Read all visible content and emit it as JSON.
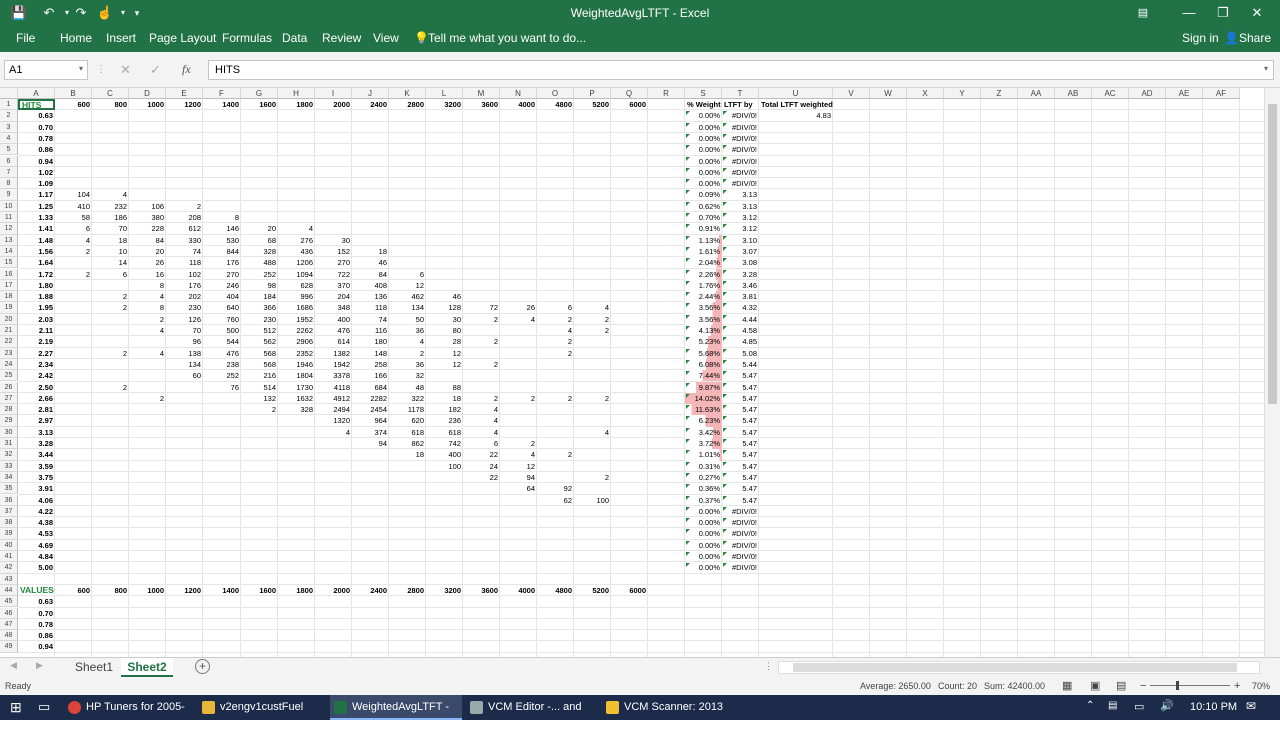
{
  "window": {
    "title": "WeightedAvgLTFT - Excel"
  },
  "ribbon": {
    "tabs": [
      "File",
      "Home",
      "Insert",
      "Page Layout",
      "Formulas",
      "Data",
      "Review",
      "View"
    ],
    "tell_me": "Tell me what you want to do...",
    "sign_in": "Sign in",
    "share": "Share"
  },
  "formula_bar": {
    "name_box": "A1",
    "value": "HITS"
  },
  "columns": [
    "A",
    "B",
    "C",
    "D",
    "E",
    "F",
    "G",
    "H",
    "I",
    "J",
    "K",
    "L",
    "M",
    "N",
    "O",
    "P",
    "Q",
    "R",
    "S",
    "T",
    "U",
    "V",
    "W",
    "X",
    "Y",
    "Z",
    "AA",
    "AB",
    "AC",
    "AD",
    "AE",
    "AF"
  ],
  "grid": {
    "header_row": {
      "label": "HITS",
      "rpm": [
        "600",
        "800",
        "1000",
        "1200",
        "1400",
        "1600",
        "1800",
        "2000",
        "2400",
        "2800",
        "3200",
        "3600",
        "4000",
        "4800",
        "5200",
        "6000"
      ],
      "s": "% Weight",
      "t": "LTFT by",
      "u": "Total LTFT weighted"
    },
    "u2": "4.83",
    "rows": [
      {
        "a": "0.63",
        "s": "0.00%",
        "t": "#DIV/0!",
        "v": {}
      },
      {
        "a": "0.70",
        "s": "0.00%",
        "t": "#DIV/0!",
        "v": {}
      },
      {
        "a": "0.78",
        "s": "0.00%",
        "t": "#DIV/0!",
        "v": {}
      },
      {
        "a": "0.86",
        "s": "0.00%",
        "t": "#DIV/0!",
        "v": {}
      },
      {
        "a": "0.94",
        "s": "0.00%",
        "t": "#DIV/0!",
        "v": {}
      },
      {
        "a": "1.02",
        "s": "0.00%",
        "t": "#DIV/0!",
        "v": {}
      },
      {
        "a": "1.09",
        "s": "0.00%",
        "t": "#DIV/0!",
        "v": {}
      },
      {
        "a": "1.17",
        "s": "0.09%",
        "t": "3.13",
        "v": {
          "B": "104",
          "C": "4"
        }
      },
      {
        "a": "1.25",
        "s": "0.62%",
        "t": "3.13",
        "v": {
          "B": "410",
          "C": "232",
          "D": "106",
          "E": "2"
        }
      },
      {
        "a": "1.33",
        "s": "0.70%",
        "t": "3.12",
        "v": {
          "B": "58",
          "C": "186",
          "D": "380",
          "E": "208",
          "F": "8"
        }
      },
      {
        "a": "1.41",
        "s": "0.91%",
        "t": "3.12",
        "v": {
          "B": "6",
          "C": "70",
          "D": "228",
          "E": "612",
          "F": "146",
          "G": "20",
          "H": "4"
        }
      },
      {
        "a": "1.48",
        "s": "1.13%",
        "t": "3.10",
        "v": {
          "B": "4",
          "C": "18",
          "D": "84",
          "E": "330",
          "F": "530",
          "G": "68",
          "H": "276",
          "I": "30"
        }
      },
      {
        "a": "1.56",
        "s": "1.61%",
        "t": "3.07",
        "v": {
          "B": "2",
          "C": "10",
          "D": "20",
          "E": "74",
          "F": "844",
          "G": "328",
          "H": "436",
          "I": "152",
          "J": "18"
        }
      },
      {
        "a": "1.64",
        "s": "2.04%",
        "t": "3.08",
        "v": {
          "C": "14",
          "D": "26",
          "E": "118",
          "F": "176",
          "G": "488",
          "H": "1206",
          "I": "270",
          "J": "46"
        }
      },
      {
        "a": "1.72",
        "s": "2.26%",
        "t": "3.28",
        "v": {
          "B": "2",
          "C": "6",
          "D": "16",
          "E": "102",
          "F": "270",
          "G": "252",
          "H": "1094",
          "I": "722",
          "J": "84",
          "K": "6"
        }
      },
      {
        "a": "1.80",
        "s": "1.76%",
        "t": "3.46",
        "v": {
          "D": "8",
          "E": "176",
          "F": "246",
          "G": "98",
          "H": "628",
          "I": "370",
          "J": "408",
          "K": "12"
        }
      },
      {
        "a": "1.88",
        "s": "2.44%",
        "t": "3.81",
        "v": {
          "C": "2",
          "D": "4",
          "E": "202",
          "F": "404",
          "G": "184",
          "H": "996",
          "I": "204",
          "J": "136",
          "K": "462",
          "L": "46"
        }
      },
      {
        "a": "1.95",
        "s": "3.56%",
        "t": "4.32",
        "v": {
          "C": "2",
          "D": "8",
          "E": "230",
          "F": "640",
          "G": "366",
          "H": "1686",
          "I": "348",
          "J": "118",
          "K": "134",
          "L": "128",
          "M": "72",
          "N": "26",
          "O": "6",
          "P": "4"
        }
      },
      {
        "a": "2.03",
        "s": "3.56%",
        "t": "4.44",
        "v": {
          "D": "2",
          "E": "126",
          "F": "760",
          "G": "230",
          "H": "1952",
          "I": "400",
          "J": "74",
          "K": "50",
          "L": "30",
          "M": "2",
          "N": "4",
          "O": "2",
          "P": "2"
        }
      },
      {
        "a": "2.11",
        "s": "4.13%",
        "t": "4.58",
        "v": {
          "D": "4",
          "E": "70",
          "F": "500",
          "G": "512",
          "H": "2262",
          "I": "476",
          "J": "116",
          "K": "36",
          "L": "80",
          "O": "4",
          "P": "2"
        }
      },
      {
        "a": "2.19",
        "s": "5.23%",
        "t": "4.85",
        "v": {
          "E": "96",
          "F": "544",
          "G": "562",
          "H": "2906",
          "I": "614",
          "J": "180",
          "K": "4",
          "L": "28",
          "M": "2",
          "O": "2"
        }
      },
      {
        "a": "2.27",
        "s": "5.68%",
        "t": "5.08",
        "v": {
          "C": "2",
          "D": "4",
          "E": "138",
          "F": "476",
          "G": "568",
          "H": "2352",
          "I": "1382",
          "J": "148",
          "K": "2",
          "L": "12",
          "O": "2"
        }
      },
      {
        "a": "2.34",
        "s": "6.08%",
        "t": "5.44",
        "v": {
          "E": "134",
          "F": "238",
          "G": "568",
          "H": "1946",
          "I": "1942",
          "J": "258",
          "K": "36",
          "L": "12",
          "M": "2"
        }
      },
      {
        "a": "2.42",
        "s": "7.44%",
        "t": "5.47",
        "v": {
          "E": "60",
          "F": "252",
          "G": "216",
          "H": "1804",
          "I": "3378",
          "J": "166",
          "K": "32"
        }
      },
      {
        "a": "2.50",
        "s": "9.87%",
        "t": "5.47",
        "v": {
          "C": "2",
          "F": "76",
          "G": "514",
          "H": "1730",
          "I": "4118",
          "J": "684",
          "K": "48",
          "L": "88"
        }
      },
      {
        "a": "2.66",
        "s": "14.02%",
        "t": "5.47",
        "v": {
          "D": "2",
          "G": "132",
          "H": "1632",
          "I": "4912",
          "J": "2282",
          "K": "322",
          "L": "18",
          "M": "2",
          "N": "2",
          "O": "2",
          "P": "2"
        }
      },
      {
        "a": "2.81",
        "s": "11.63%",
        "t": "5.47",
        "v": {
          "G": "2",
          "H": "328",
          "I": "2494",
          "J": "2454",
          "K": "1178",
          "L": "182",
          "M": "4"
        }
      },
      {
        "a": "2.97",
        "s": "6.23%",
        "t": "5.47",
        "v": {
          "I": "1320",
          "J": "964",
          "K": "620",
          "L": "236",
          "M": "4"
        }
      },
      {
        "a": "3.13",
        "s": "3.42%",
        "t": "5.47",
        "v": {
          "I": "4",
          "J": "374",
          "K": "618",
          "L": "618",
          "M": "4",
          "P": "4"
        }
      },
      {
        "a": "3.28",
        "s": "3.72%",
        "t": "5.47",
        "v": {
          "J": "94",
          "K": "862",
          "L": "742",
          "M": "6",
          "N": "2"
        }
      },
      {
        "a": "3.44",
        "s": "1.01%",
        "t": "5.47",
        "v": {
          "K": "18",
          "L": "400",
          "M": "22",
          "N": "4",
          "O": "2"
        }
      },
      {
        "a": "3.59",
        "s": "0.31%",
        "t": "5.47",
        "v": {
          "L": "100",
          "M": "24",
          "N": "12"
        }
      },
      {
        "a": "3.75",
        "s": "0.27%",
        "t": "5.47",
        "v": {
          "M": "22",
          "N": "94",
          "P": "2"
        }
      },
      {
        "a": "3.91",
        "s": "0.36%",
        "t": "5.47",
        "v": {
          "N": "64",
          "O": "92"
        }
      },
      {
        "a": "4.06",
        "s": "0.37%",
        "t": "5.47",
        "v": {
          "O": "62",
          "P": "100"
        }
      },
      {
        "a": "4.22",
        "s": "0.00%",
        "t": "#DIV/0!",
        "v": {}
      },
      {
        "a": "4.38",
        "s": "0.00%",
        "t": "#DIV/0!",
        "v": {}
      },
      {
        "a": "4.53",
        "s": "0.00%",
        "t": "#DIV/0!",
        "v": {}
      },
      {
        "a": "4.69",
        "s": "0.00%",
        "t": "#DIV/0!",
        "v": {}
      },
      {
        "a": "4.84",
        "s": "0.00%",
        "t": "#DIV/0!",
        "v": {}
      },
      {
        "a": "5.00",
        "s": "0.00%",
        "t": "#DIV/0!",
        "v": {}
      }
    ],
    "values_row": {
      "label": "VALUES",
      "rpm": [
        "600",
        "800",
        "1000",
        "1200",
        "1400",
        "1600",
        "1800",
        "2000",
        "2400",
        "2800",
        "3200",
        "3600",
        "4000",
        "4800",
        "5200",
        "6000"
      ]
    },
    "values_rows": [
      "0.63",
      "0.70",
      "0.78",
      "0.86",
      "0.94"
    ]
  },
  "sheets": [
    "Sheet1",
    "Sheet2"
  ],
  "status": {
    "ready": "Ready",
    "average": "Average: 2650.00",
    "count": "Count: 20",
    "sum": "Sum: 42400.00",
    "zoom": "70%"
  },
  "taskbar": {
    "items": [
      "HP Tuners for 2005-20...",
      "v2engv1custFuel",
      "WeightedAvgLTFT - E...",
      "VCM Editor -... and Tu...",
      "VCM Scanner: 2013 To..."
    ],
    "time": "10:10 PM"
  }
}
